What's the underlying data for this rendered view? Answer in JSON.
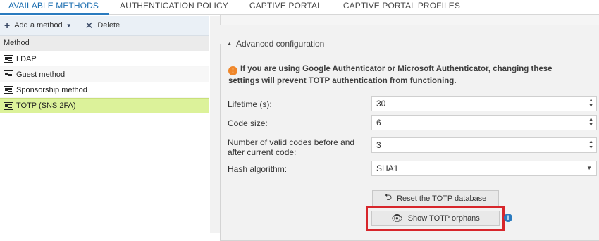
{
  "tabs": [
    {
      "label": "AVAILABLE METHODS",
      "active": true
    },
    {
      "label": "AUTHENTICATION POLICY"
    },
    {
      "label": "CAPTIVE PORTAL"
    },
    {
      "label": "CAPTIVE PORTAL PROFILES"
    }
  ],
  "toolbar": {
    "add_label": "Add a method",
    "delete_label": "Delete"
  },
  "table": {
    "column": "Method",
    "rows": [
      {
        "label": "LDAP"
      },
      {
        "label": "Guest method"
      },
      {
        "label": "Sponsorship method"
      },
      {
        "label": "TOTP (SNS 2FA)",
        "selected": true
      }
    ]
  },
  "advanced": {
    "legend": "Advanced configuration",
    "warning": "If you are using Google Authenticator or Microsoft Authenticator, changing these settings will prevent TOTP authentication from functioning.",
    "fields": {
      "lifetime_label": "Lifetime (s):",
      "lifetime_value": "30",
      "code_size_label": "Code size:",
      "code_size_value": "6",
      "valid_codes_label": "Number of valid codes before and after current code:",
      "valid_codes_value": "3",
      "hash_label": "Hash algorithm:",
      "hash_value": "SHA1"
    },
    "reset_button": "Reset the TOTP database",
    "orphans_button": "Show TOTP orphans"
  },
  "colors": {
    "accent": "#2a7bbf",
    "selected_row": "#dcf29a",
    "warning": "#f0872a",
    "highlight": "#d7262b"
  }
}
